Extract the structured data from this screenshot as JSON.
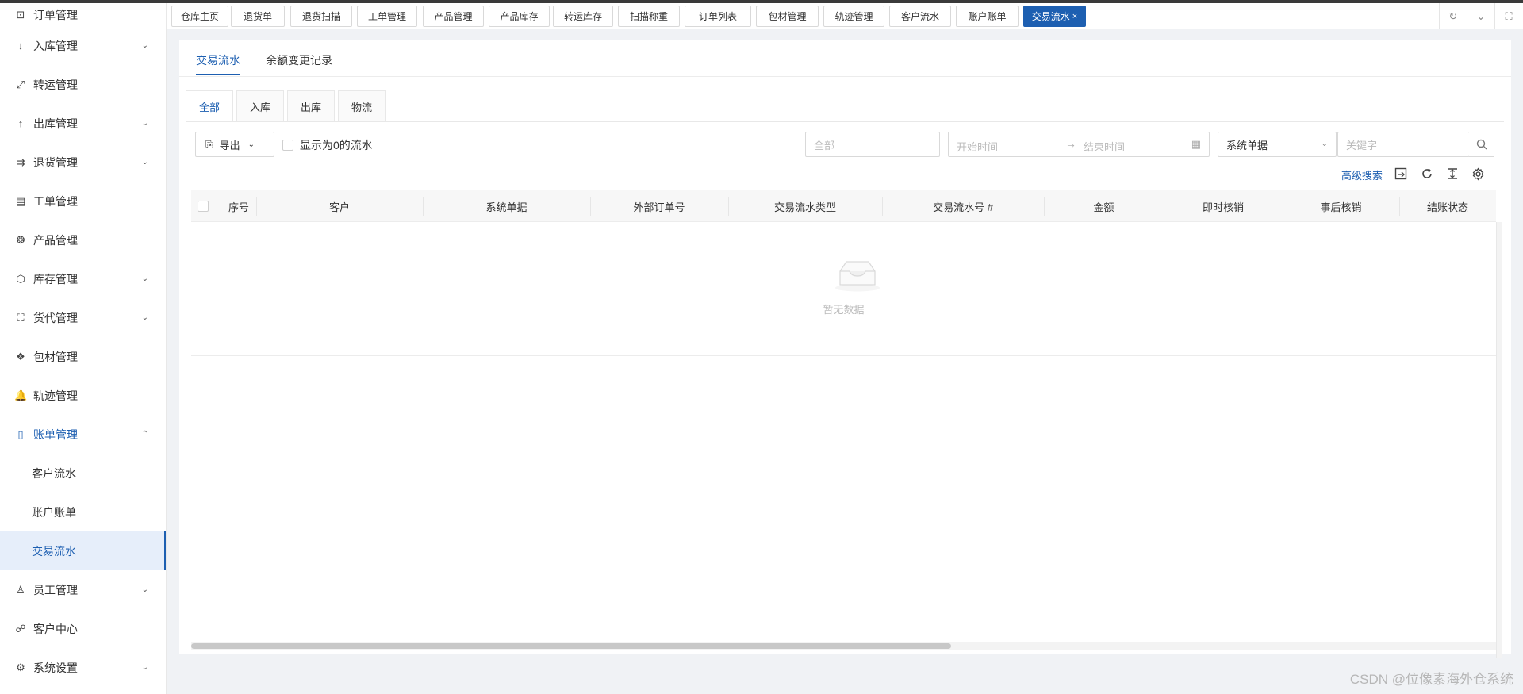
{
  "sidebar": {
    "items": [
      {
        "label": "订单管理",
        "icon": "order-icon",
        "glyph": "⊡",
        "chevron": ""
      },
      {
        "label": "入库管理",
        "icon": "arrow-down-icon",
        "glyph": "↓",
        "chevron": "⌄"
      },
      {
        "label": "转运管理",
        "icon": "transfer-icon",
        "glyph": "⤢",
        "chevron": ""
      },
      {
        "label": "出库管理",
        "icon": "arrow-up-icon",
        "glyph": "↑",
        "chevron": "⌄"
      },
      {
        "label": "退货管理",
        "icon": "return-icon",
        "glyph": "⇉",
        "chevron": "⌄"
      },
      {
        "label": "工单管理",
        "icon": "work-order-icon",
        "glyph": "▤",
        "chevron": ""
      },
      {
        "label": "产品管理",
        "icon": "product-icon",
        "glyph": "❂",
        "chevron": ""
      },
      {
        "label": "库存管理",
        "icon": "inventory-cube-icon",
        "glyph": "⬡",
        "chevron": "⌄"
      },
      {
        "label": "货代管理",
        "icon": "forwarder-icon",
        "glyph": "⛶",
        "chevron": "⌄"
      },
      {
        "label": "包材管理",
        "icon": "packaging-icon",
        "glyph": "❖",
        "chevron": ""
      },
      {
        "label": "轨迹管理",
        "icon": "bell-icon",
        "glyph": "🔔",
        "chevron": ""
      },
      {
        "label": "账单管理",
        "icon": "bill-icon",
        "glyph": "▯",
        "chevron": "⌃",
        "open": true
      },
      {
        "label": "客户流水",
        "sub": true
      },
      {
        "label": "账户账单",
        "sub": true
      },
      {
        "label": "交易流水",
        "sub": true,
        "active": true
      },
      {
        "label": "员工管理",
        "icon": "user-icon",
        "glyph": "♙",
        "chevron": "⌄"
      },
      {
        "label": "客户中心",
        "icon": "customer-icon",
        "glyph": "☍",
        "chevron": ""
      },
      {
        "label": "系统设置",
        "icon": "gear-icon",
        "glyph": "⚙",
        "chevron": "⌄"
      }
    ]
  },
  "tabs": [
    {
      "label": "仓库主页"
    },
    {
      "label": "退货单"
    },
    {
      "label": "退货扫描"
    },
    {
      "label": "工单管理"
    },
    {
      "label": "产品管理"
    },
    {
      "label": "产品库存"
    },
    {
      "label": "转运库存"
    },
    {
      "label": "扫描称重"
    },
    {
      "label": "订单列表"
    },
    {
      "label": "包材管理"
    },
    {
      "label": "轨迹管理"
    },
    {
      "label": "客户流水"
    },
    {
      "label": "账户账单"
    },
    {
      "label": "交易流水",
      "active": true,
      "close": "×"
    }
  ],
  "tab_controls": {
    "refresh": "↻",
    "dropdown": "⌄",
    "fullscreen": "⛶"
  },
  "page": {
    "top_tabs": [
      "交易流水",
      "余额变更记录"
    ],
    "sub_tabs": [
      "全部",
      "入库",
      "出库",
      "物流"
    ],
    "toolbar": {
      "export_label": "导出",
      "show_zero_label": "显示为0的流水",
      "customer_placeholder": "全部",
      "start_placeholder": "开始时间",
      "end_placeholder": "结束时间",
      "select_value": "系统单据",
      "keyword_placeholder": "关键字",
      "advanced_search": "高级搜索"
    },
    "table": {
      "columns": [
        "序号",
        "客户",
        "系统单据",
        "外部订单号",
        "交易流水类型",
        "交易流水号 #",
        "金额",
        "即时核销",
        "事后核销",
        "结账状态"
      ],
      "rows": [],
      "empty_text": "暂无数据"
    }
  },
  "watermark": "CSDN @位像素海外仓系统",
  "colors": {
    "primary": "#1d5fb1",
    "active_bg": "#e6eefa"
  }
}
